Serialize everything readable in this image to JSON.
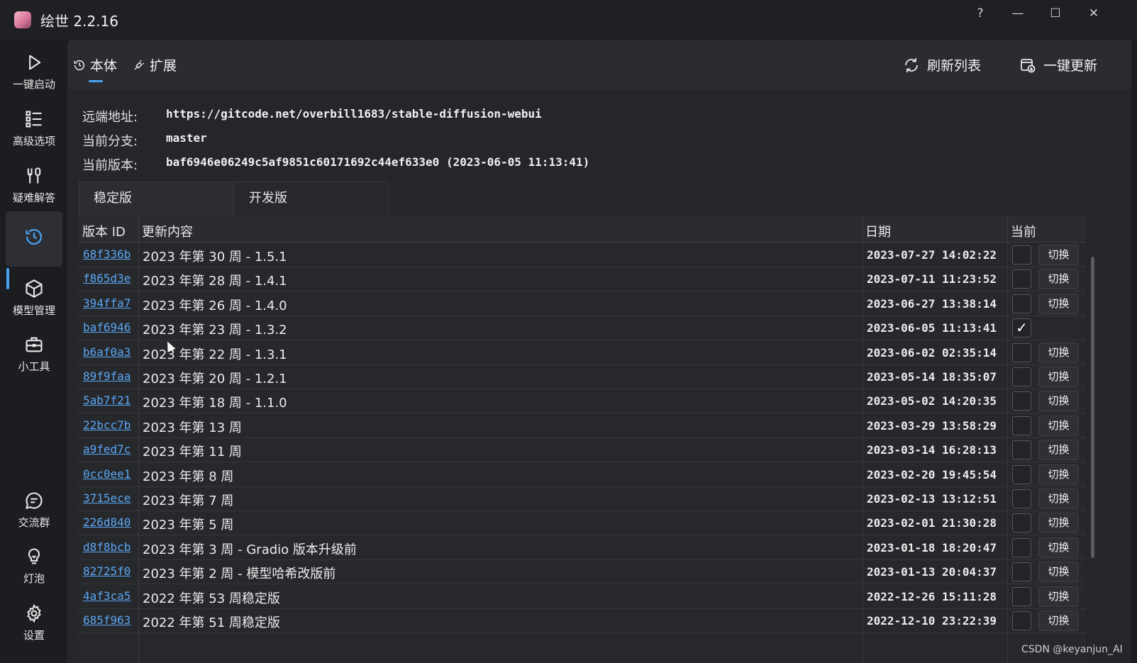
{
  "window": {
    "title": "绘世 2.2.16",
    "help": "?",
    "minimize": "—",
    "maximize": "☐",
    "close": "✕"
  },
  "nav": {
    "items": [
      {
        "label": "一键启动",
        "icon": "play-icon"
      },
      {
        "label": "高级选项",
        "icon": "list-icon"
      },
      {
        "label": "疑难解答",
        "icon": "tools-icon"
      },
      {
        "label": "",
        "icon": "history-icon",
        "active": true
      },
      {
        "label": "模型管理",
        "icon": "cube-icon"
      },
      {
        "label": "小工具",
        "icon": "toolbox-icon"
      },
      {
        "label": "交流群",
        "icon": "chat-icon"
      },
      {
        "label": "灯泡",
        "icon": "bulb-icon"
      },
      {
        "label": "设置",
        "icon": "gear-icon"
      }
    ]
  },
  "topbar": {
    "tab_main": "本体",
    "tab_ext": "扩展",
    "refresh": "刷新列表",
    "update_all": "一键更新"
  },
  "info": {
    "remote_label": "远端地址:",
    "remote_value": "https://gitcode.net/overbill1683/stable-diffusion-webui",
    "branch_label": "当前分支:",
    "branch_value": "master",
    "version_label": "当前版本:",
    "version_value": "baf6946e06249c5af9851c60171692c44ef633e0 (2023-06-05 11:13:41)"
  },
  "subtabs": {
    "stable": "稳定版",
    "dev": "开发版"
  },
  "table": {
    "headers": {
      "id": "版本 ID",
      "msg": "更新内容",
      "date": "日期",
      "current": "当前"
    },
    "switch_label": "切换",
    "rows": [
      {
        "id": "68f336b",
        "msg": "2023 年第 30 周 - 1.5.1",
        "date": "2023-07-27 14:02:22",
        "current": false
      },
      {
        "id": "f865d3e",
        "msg": "2023 年第 28 周 - 1.4.1",
        "date": "2023-07-11 11:23:52",
        "current": false
      },
      {
        "id": "394ffa7",
        "msg": "2023 年第 26 周 - 1.4.0",
        "date": "2023-06-27 13:38:14",
        "current": false
      },
      {
        "id": "baf6946",
        "msg": "2023 年第 23 周 - 1.3.2",
        "date": "2023-06-05 11:13:41",
        "current": true
      },
      {
        "id": "b6af0a3",
        "msg": "2023 年第 22 周 - 1.3.1",
        "date": "2023-06-02 02:35:14",
        "current": false
      },
      {
        "id": "89f9faa",
        "msg": "2023 年第 20 周 - 1.2.1",
        "date": "2023-05-14 18:35:07",
        "current": false
      },
      {
        "id": "5ab7f21",
        "msg": "2023 年第 18 周 - 1.1.0",
        "date": "2023-05-02 14:20:35",
        "current": false
      },
      {
        "id": "22bcc7b",
        "msg": "2023 年第 13 周",
        "date": "2023-03-29 13:58:29",
        "current": false
      },
      {
        "id": "a9fed7c",
        "msg": "2023 年第 11 周",
        "date": "2023-03-14 16:28:13",
        "current": false
      },
      {
        "id": "0cc0ee1",
        "msg": "2023 年第 8 周",
        "date": "2023-02-20 19:45:54",
        "current": false
      },
      {
        "id": "3715ece",
        "msg": "2023 年第 7 周",
        "date": "2023-02-13 13:12:51",
        "current": false
      },
      {
        "id": "226d840",
        "msg": "2023 年第 5 周",
        "date": "2023-02-01 21:30:28",
        "current": false
      },
      {
        "id": "d8f8bcb",
        "msg": "2023 年第 3 周 - Gradio 版本升级前",
        "date": "2023-01-18 18:20:47",
        "current": false
      },
      {
        "id": "82725f0",
        "msg": "2023 年第 2 周 - 模型哈希改版前",
        "date": "2023-01-13 20:04:37",
        "current": false
      },
      {
        "id": "4af3ca5",
        "msg": "2022 年第 53 周稳定版",
        "date": "2022-12-26 15:11:28",
        "current": false
      },
      {
        "id": "685f963",
        "msg": "2022 年第 51 周稳定版",
        "date": "2022-12-10 23:22:39",
        "current": false
      }
    ]
  },
  "watermark": "CSDN @keyanjun_AI",
  "colors": {
    "accent": "#4aa3f0",
    "link": "#5aa6f2",
    "background": "#1c1d21"
  }
}
